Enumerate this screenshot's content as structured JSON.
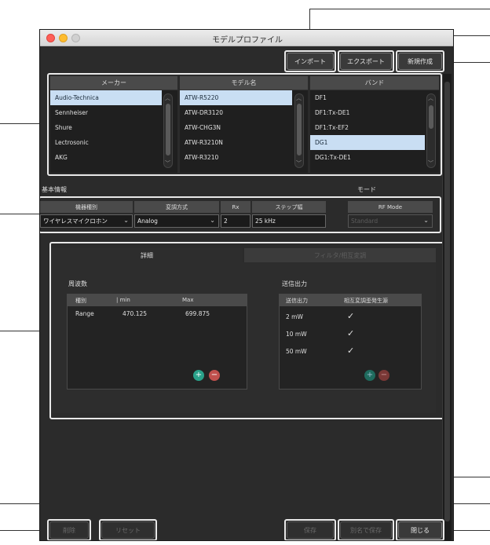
{
  "window": {
    "title": "モデルプロファイル"
  },
  "toolbar": {
    "import_label": "インポート",
    "export_label": "エクスポート",
    "new_label": "新規作成"
  },
  "lists": {
    "maker": {
      "header": "メーカー",
      "items": [
        "Audio-Technica",
        "Sennheiser",
        "Shure",
        "Lectrosonic",
        "AKG"
      ],
      "selected": 0
    },
    "model": {
      "header": "モデル名",
      "items": [
        "ATW-R5220",
        "ATW-DR3120",
        "ATW-CHG3N",
        "ATW-R3210N",
        "ATW-R3210"
      ],
      "selected": 0
    },
    "band": {
      "header": "バンド",
      "items": [
        "DF1",
        "DF1:Tx-DE1",
        "DF1:Tx-EF2",
        "DG1",
        "DG1:Tx-DE1"
      ],
      "selected": 3
    }
  },
  "basic": {
    "section_label": "基本情報",
    "mode_label": "モード",
    "headers": {
      "device_type": "機器種別",
      "modulation": "変調方式",
      "rx": "Rx",
      "step": "ステップ幅",
      "rf_mode": "RF Mode"
    },
    "values": {
      "device_type": "ワイヤレスマイクロホン",
      "modulation": "Analog",
      "rx": "2",
      "step": "25 kHz",
      "rf_mode": "Standard"
    }
  },
  "detail": {
    "tab_detail": "詳細",
    "tab_filter": "フィルタ/相互変調",
    "freq": {
      "label": "周波数",
      "headers": {
        "type": "種別",
        "min": "min",
        "max": "Max"
      },
      "rows": [
        {
          "type": "Range",
          "min": "470.125",
          "max": "699.875"
        }
      ]
    },
    "power": {
      "label": "送信出力",
      "headers": {
        "power": "送信出力",
        "imd": "相互変調歪発生源"
      },
      "rows": [
        {
          "power": "2 mW",
          "imd": "✓"
        },
        {
          "power": "10 mW",
          "imd": "✓"
        },
        {
          "power": "50 mW",
          "imd": "✓"
        }
      ]
    },
    "add_symbol": "+",
    "remove_symbol": "−"
  },
  "footer": {
    "delete_label": "削除",
    "reset_label": "リセット",
    "save_label": "保存",
    "save_as_label": "別名で保存",
    "close_label": "閉じる"
  }
}
